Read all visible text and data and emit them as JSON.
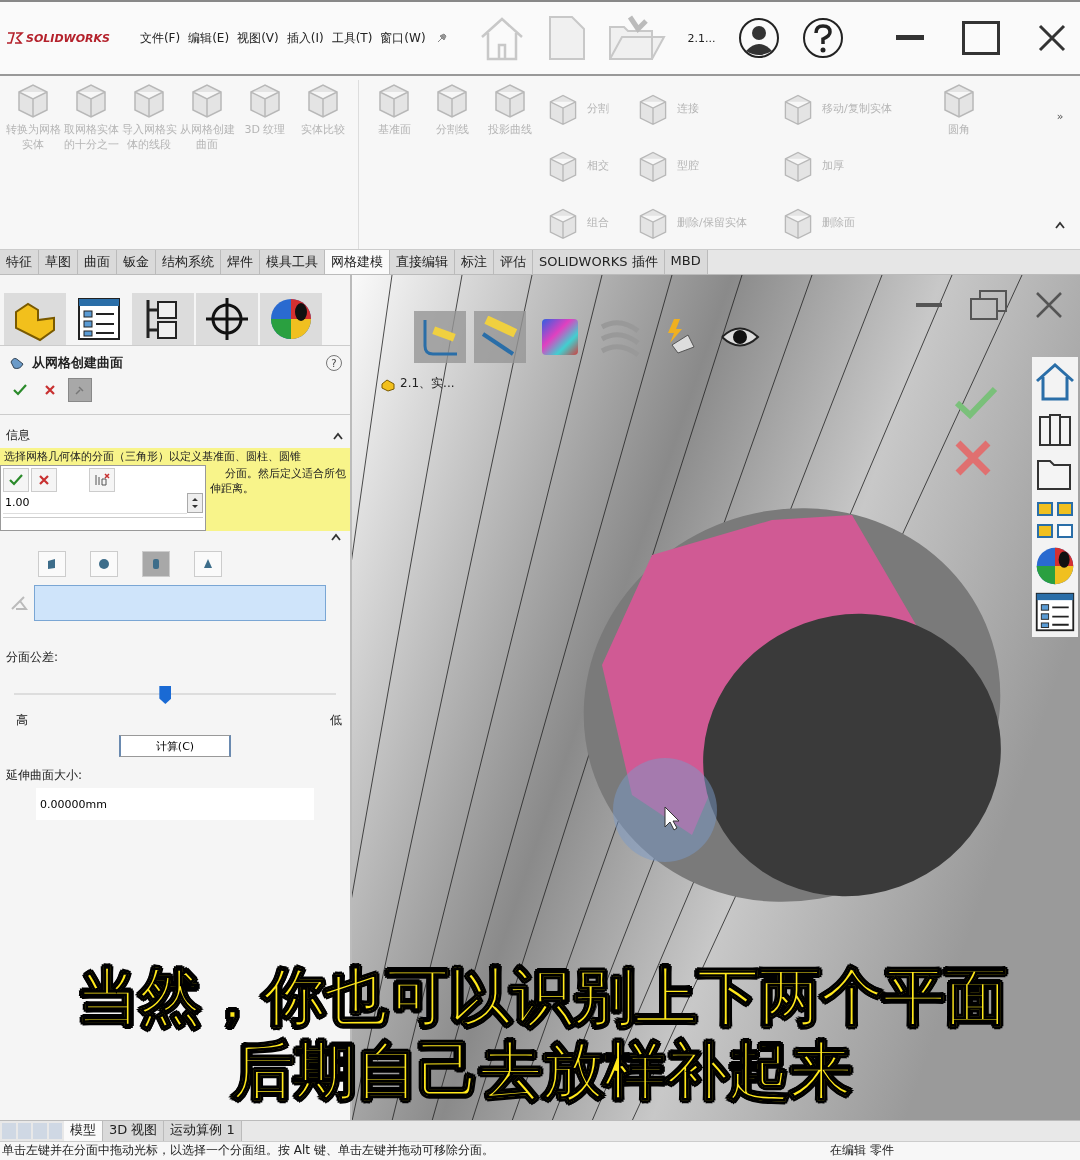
{
  "title_bar": {
    "logo": "SOLIDWORKS",
    "menus": [
      "文件(F)",
      "编辑(E)",
      "视图(V)",
      "插入(I)",
      "工具(T)",
      "窗口(W)"
    ],
    "document": "2.1..."
  },
  "ribbon": {
    "large_tools": [
      {
        "label": "转换为网格实体",
        "disabled": true
      },
      {
        "label": "取网格实体的十分之一",
        "disabled": true
      },
      {
        "label": "导入网格实体的线段",
        "disabled": true
      },
      {
        "label": "从网格创建曲面",
        "disabled": true
      },
      {
        "label": "3D 纹理",
        "disabled": true
      },
      {
        "label": "实体比较",
        "disabled": true
      }
    ],
    "ref_tools": [
      {
        "label": "基准面",
        "disabled": true
      },
      {
        "label": "分割线",
        "disabled": true
      },
      {
        "label": "投影曲线",
        "disabled": true
      }
    ],
    "small_tools": [
      {
        "label": "分割",
        "disabled": true
      },
      {
        "label": "连接",
        "disabled": true
      },
      {
        "label": "移动/复制实体",
        "disabled": true
      },
      {
        "label": "相交",
        "disabled": true
      },
      {
        "label": "型腔",
        "disabled": true
      },
      {
        "label": "加厚",
        "disabled": true
      },
      {
        "label": "组合",
        "disabled": true
      },
      {
        "label": "删除/保留实体",
        "disabled": true
      },
      {
        "label": "删除面",
        "disabled": true
      }
    ],
    "fillet": {
      "label": "圆角",
      "disabled": true
    },
    "more": "»"
  },
  "tabs": [
    {
      "label": "特征",
      "selected": false
    },
    {
      "label": "草图",
      "selected": false
    },
    {
      "label": "曲面",
      "selected": false
    },
    {
      "label": "钣金",
      "selected": false
    },
    {
      "label": "结构系统",
      "selected": false
    },
    {
      "label": "焊件",
      "selected": false
    },
    {
      "label": "模具工具",
      "selected": false
    },
    {
      "label": "网格建模",
      "selected": true
    },
    {
      "label": "直接编辑",
      "selected": false
    },
    {
      "label": "标注",
      "selected": false
    },
    {
      "label": "评估",
      "selected": false
    },
    {
      "label": "SOLIDWORKS 插件",
      "selected": false
    },
    {
      "label": "MBD",
      "selected": false
    }
  ],
  "property_manager": {
    "tabs": [
      {
        "kind": "feature",
        "selected": false
      },
      {
        "kind": "property",
        "selected": true
      },
      {
        "kind": "config",
        "selected": false
      },
      {
        "kind": "dimxpert",
        "selected": false
      },
      {
        "kind": "display",
        "selected": false
      }
    ],
    "title": "从网格创建曲面",
    "help": "?",
    "info": {
      "heading": "信息",
      "lines": [
        "选择网格几何体的分面（三角形）以定义基准面、圆柱、圆锥",
        "分面。然后定义适合所包",
        "伸距离。"
      ]
    },
    "popup": {
      "value": "1.00"
    },
    "shape_buttons": [
      {
        "kind": "plane",
        "selected": false
      },
      {
        "kind": "sphere",
        "selected": false
      },
      {
        "kind": "cylinder",
        "selected": true
      },
      {
        "kind": "cone",
        "selected": false
      }
    ],
    "tolerance": {
      "label": "分面公差:",
      "level": 0.47,
      "high": "高",
      "low": "低"
    },
    "compute": "计算(C)",
    "extend": {
      "label": "延伸曲面大小:",
      "value": "0.00000mm"
    }
  },
  "viewport": {
    "tree_item": "2.1、实...",
    "subtitles": [
      "当然，你也可以识别上下两个平面",
      "后期自己去放样补起来"
    ]
  },
  "bottom_tabs": [
    {
      "label": "模型",
      "selected": true
    },
    {
      "label": "3D 视图",
      "selected": false
    },
    {
      "label": "运动算例 1",
      "selected": false
    }
  ],
  "status_bar": {
    "message": "单击左键并在分面中拖动光标，以选择一个分面组。按 Alt 键、单击左键并拖动可移除分面。",
    "mode": "在编辑 零件"
  }
}
